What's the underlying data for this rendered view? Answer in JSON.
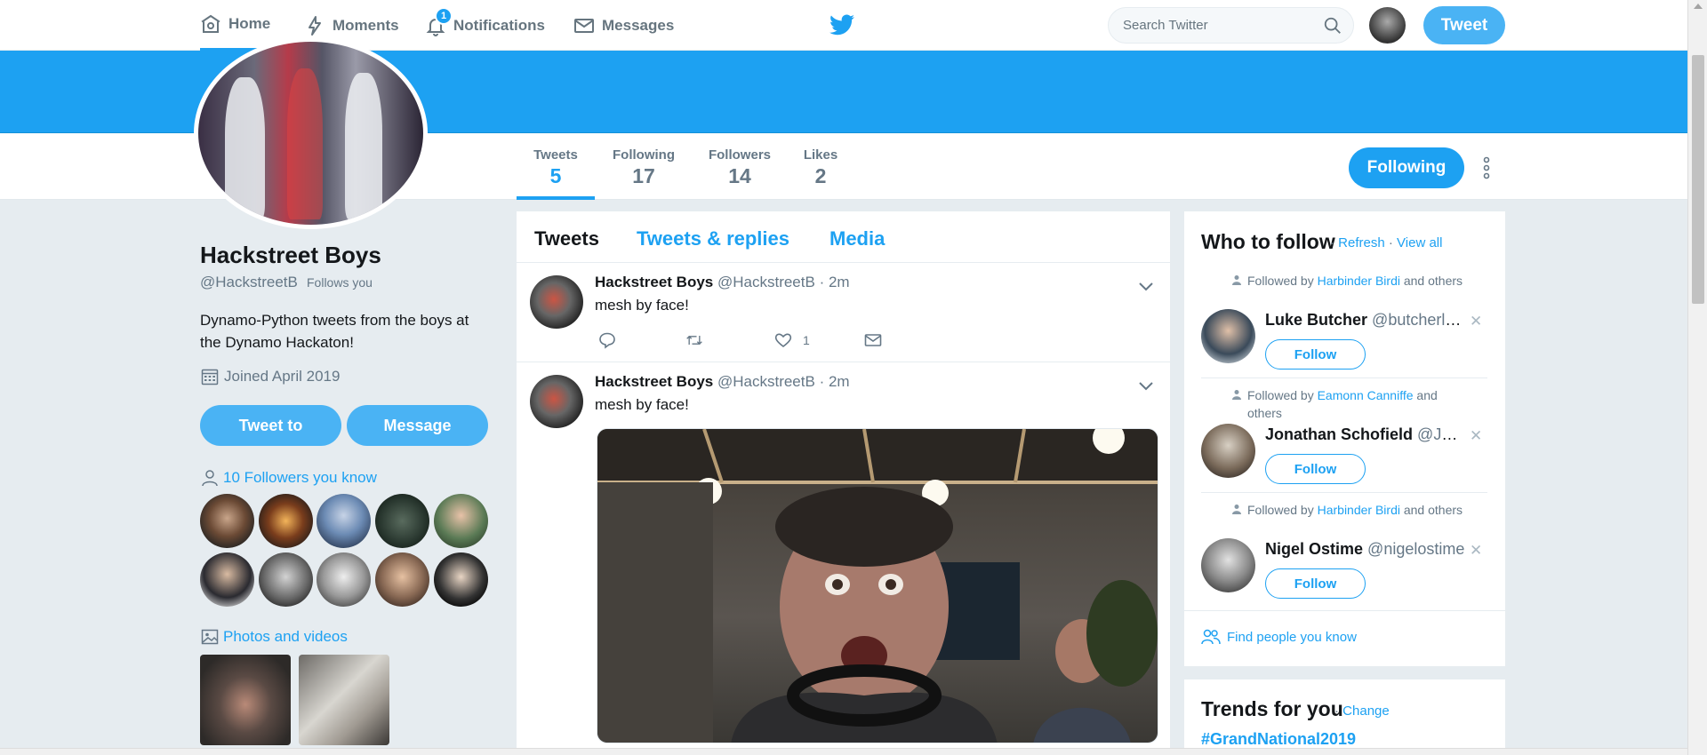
{
  "nav": {
    "home": "Home",
    "moments": "Moments",
    "notifications": "Notifications",
    "notifications_badge": "1",
    "messages": "Messages",
    "search_placeholder": "Search Twitter",
    "tweet_button": "Tweet"
  },
  "profile_nav": {
    "stats": [
      {
        "label": "Tweets",
        "value": "5"
      },
      {
        "label": "Following",
        "value": "17"
      },
      {
        "label": "Followers",
        "value": "14"
      },
      {
        "label": "Likes",
        "value": "2"
      }
    ],
    "following_button": "Following"
  },
  "profile": {
    "name": "Hackstreet Boys",
    "handle": "@HackstreetB",
    "follows_you": "Follows you",
    "bio": "Dynamo-Python tweets from the boys at the Dynamo Hackaton!",
    "joined": "Joined April 2019",
    "tweet_to": "Tweet to",
    "message": "Message",
    "followers_you_know": "10 Followers you know",
    "photos_videos": "Photos and videos"
  },
  "timeline": {
    "tabs": [
      "Tweets",
      "Tweets & replies",
      "Media"
    ],
    "tweets": [
      {
        "name": "Hackstreet Boys",
        "handle": "@HackstreetB",
        "time": "· 2m",
        "text": "mesh by face!",
        "likes": "1"
      },
      {
        "name": "Hackstreet Boys",
        "handle": "@HackstreetB",
        "time": "· 2m",
        "text": "mesh by face!"
      }
    ]
  },
  "who_to_follow": {
    "title": "Who to follow",
    "refresh": "Refresh",
    "view_all": "View all",
    "suggestions": [
      {
        "followed_by_prefix": "Followed by",
        "followed_by_name": "Harbinder Birdi",
        "followed_by_suffix": "and others",
        "name": "Luke Butcher",
        "handle": "@butcherluke",
        "follow": "Follow"
      },
      {
        "followed_by_prefix": "Followed by",
        "followed_by_name": "Eamonn Canniffe",
        "followed_by_suffix": "and others",
        "name": "Jonathan Schofield",
        "handle": "@Jon...",
        "follow": "Follow"
      },
      {
        "followed_by_prefix": "Followed by",
        "followed_by_name": "Harbinder Birdi",
        "followed_by_suffix": "and others",
        "name": "Nigel Ostime",
        "handle": "@nigelostime",
        "follow": "Follow"
      }
    ],
    "find_people": "Find people you know"
  },
  "trends": {
    "title": "Trends for you",
    "change": "Change",
    "items": [
      "#GrandNational2019"
    ]
  },
  "colors": {
    "accent": "#1da1f2",
    "background": "#e6ecf0",
    "muted": "#657786"
  },
  "icons": [
    "home-icon",
    "moments-icon",
    "bell-icon",
    "envelope-icon",
    "twitter-bird-icon",
    "search-icon",
    "calendar-icon",
    "person-icon",
    "image-icon",
    "reply-icon",
    "retweet-icon",
    "heart-icon",
    "dm-icon",
    "chevron-down-icon",
    "close-icon",
    "people-icon",
    "more-dots-icon"
  ]
}
